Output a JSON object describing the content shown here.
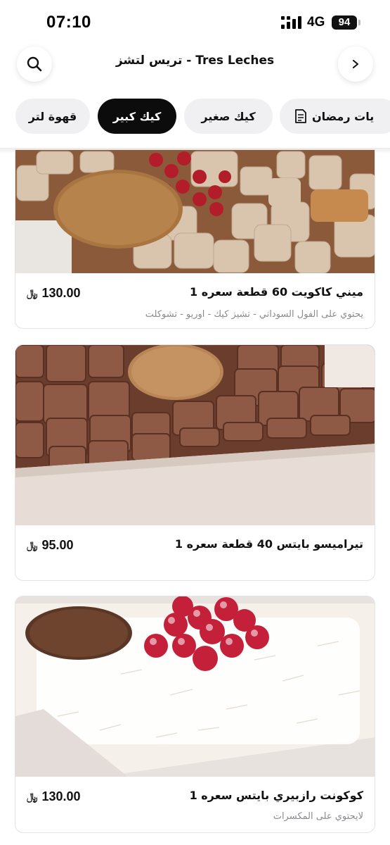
{
  "status_bar": {
    "time": "07:10",
    "network": "4G",
    "battery": "94"
  },
  "header": {
    "title": "تريس لتشز - Tres Leches"
  },
  "tabs": [
    {
      "label": "يات رمضان",
      "active": false
    },
    {
      "label": "كيك صغير",
      "active": false
    },
    {
      "label": "كيك كبير",
      "active": true
    },
    {
      "label": "قهوة لتر",
      "active": false
    }
  ],
  "currency_symbol": "﷼",
  "products": [
    {
      "name": "ميني كاكويت 60 قطعة سعره 1",
      "description": "يحتوي على الفول السوداني - تشيز كيك - اوريو - تشوكلت",
      "price": "130.00"
    },
    {
      "name": "تيراميسو بايتس 40 قطعة سعره 1",
      "description": "",
      "price": "95.00"
    },
    {
      "name": "كوكونت رازبيري بايتس سعره 1",
      "description": "لايحتوي على المكسرات",
      "price": "130.00"
    }
  ],
  "colors": {
    "active_tab": "#0c0c0c",
    "inactive_tab": "#f0f0f3",
    "muted_text": "#8a8a8f"
  }
}
